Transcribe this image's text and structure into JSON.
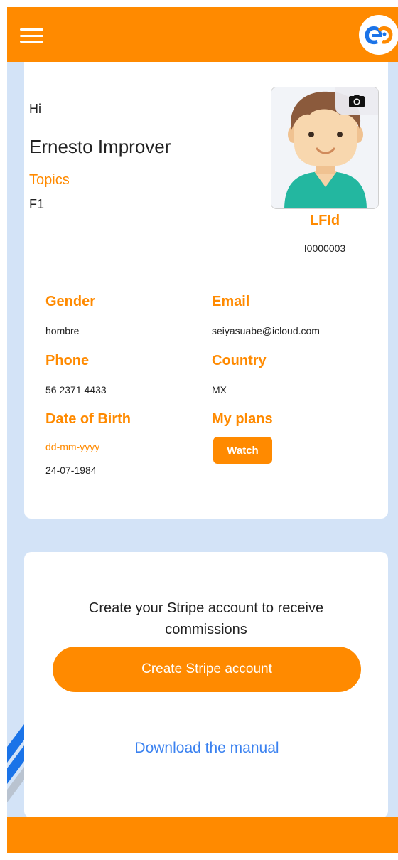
{
  "profile": {
    "greeting": "Hi",
    "name": "Ernesto Improver",
    "topics_label": "Topics",
    "topics_value": "F1",
    "lfid_label": "LFId",
    "lfid_value": "I0000003"
  },
  "fields": {
    "gender_label": "Gender",
    "gender_value": "hombre",
    "email_label": "Email",
    "email_value": "seiyasuabe@icloud.com",
    "phone_label": "Phone",
    "phone_value": "56 2371 4433",
    "country_label": "Country",
    "country_value": "MX",
    "dob_label": "Date of Birth",
    "dob_hint": "dd-mm-yyyy",
    "dob_value": "24-07-1984",
    "plans_label": "My plans",
    "plans_button": "Watch"
  },
  "stripe": {
    "message": "Create your Stripe account to receive commissions",
    "button_label": "Create Stripe account",
    "manual_link": "Download the manual"
  },
  "icons": {
    "menu": "hamburger-menu-icon",
    "logo": "app-logo",
    "camera": "camera-icon",
    "avatar": "user-avatar"
  },
  "colors": {
    "accent": "#ff8a00",
    "background": "#d3e3f7",
    "link": "#3b82f0"
  }
}
